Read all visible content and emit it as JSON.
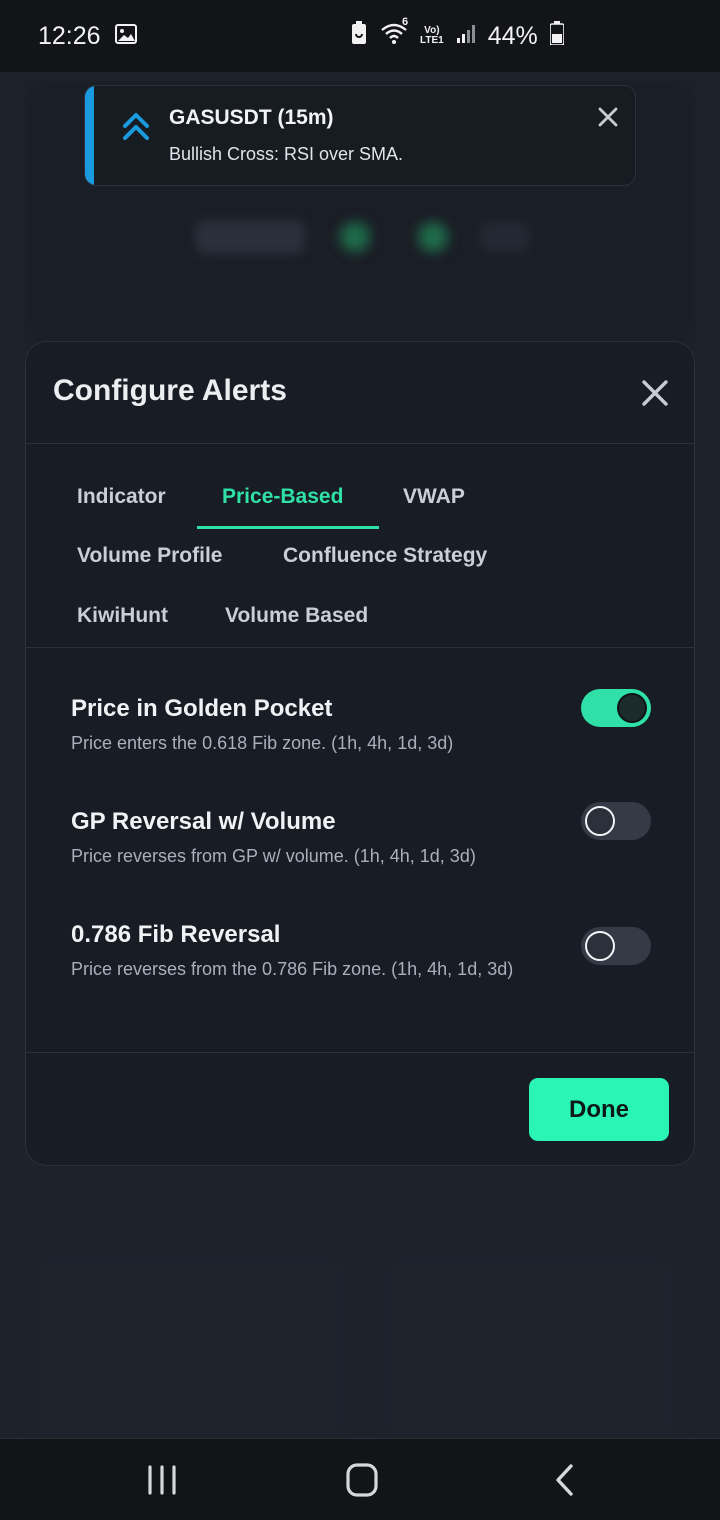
{
  "status_bar": {
    "time": "12:26",
    "battery_percent": "44%",
    "network_label_top": "Vo)",
    "network_label_bottom": "LTE1",
    "wifi_badge": "6",
    "icons": [
      "gallery-icon",
      "battery-saver-icon",
      "wifi-icon",
      "signal-icon",
      "battery-icon"
    ]
  },
  "toast": {
    "title": "GASUSDT (15m)",
    "message": "Bullish Cross: RSI over SMA.",
    "accent_color": "#1a9be0",
    "icon": "double-chevron-up-icon"
  },
  "modal": {
    "title": "Configure Alerts",
    "tabs": [
      {
        "label": "Indicator",
        "active": false
      },
      {
        "label": "Price-Based",
        "active": true
      },
      {
        "label": "VWAP",
        "active": false
      },
      {
        "label": "Volume Profile",
        "active": false
      },
      {
        "label": "Confluence Strategy",
        "active": false
      },
      {
        "label": "KiwiHunt",
        "active": false
      },
      {
        "label": "Volume Based",
        "active": false
      }
    ],
    "alerts": [
      {
        "title": "Price in Golden Pocket",
        "description": "Price enters the 0.618 Fib zone. (1h, 4h, 1d, 3d)",
        "enabled": true
      },
      {
        "title": "GP Reversal w/ Volume",
        "description": "Price reverses from GP w/ volume. (1h, 4h, 1d, 3d)",
        "enabled": false
      },
      {
        "title": "0.786 Fib Reversal",
        "description": "Price reverses from the 0.786 Fib zone. (1h, 4h, 1d, 3d)",
        "enabled": false
      }
    ],
    "done_label": "Done",
    "accent_color": "#2fe0a7"
  },
  "nav_bar": {
    "buttons": [
      "recent-apps",
      "home",
      "back"
    ]
  }
}
